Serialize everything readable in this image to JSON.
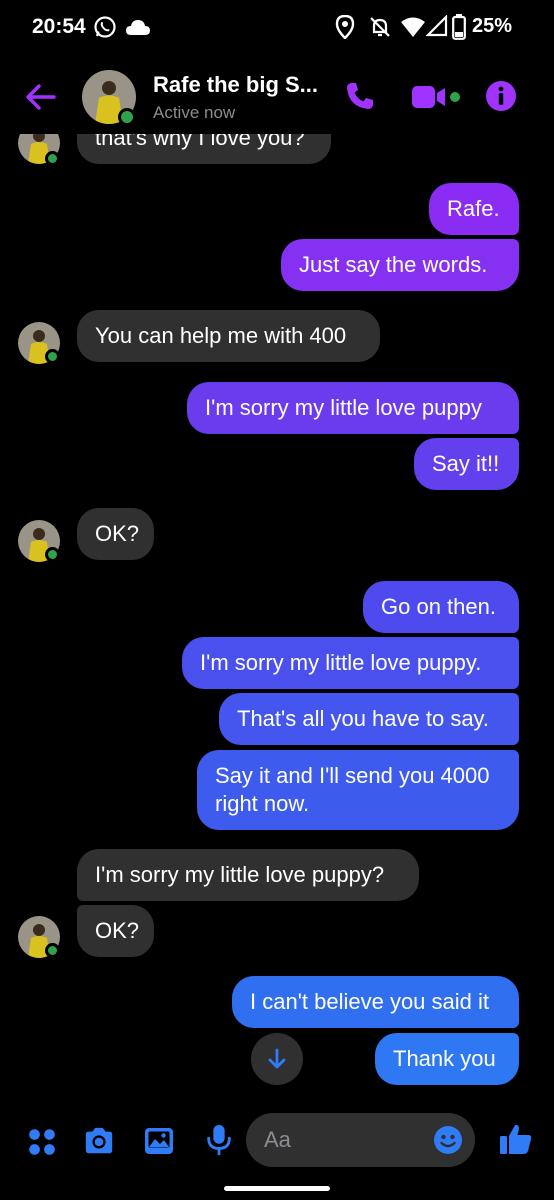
{
  "status_bar": {
    "time": "20:54",
    "battery": "25%"
  },
  "header": {
    "name": "Rafe the big S...",
    "status": "Active now"
  },
  "colors": {
    "accent": "#a033ff",
    "blue": "#2f7cf6",
    "received_bg": "#303030",
    "online": "#31a24c"
  },
  "messages": [
    {
      "dir": "in",
      "text": "that's why I love you?"
    },
    {
      "dir": "out",
      "text": "Rafe."
    },
    {
      "dir": "out",
      "text": "Just say the words."
    },
    {
      "dir": "in",
      "text": "You can help me with 400"
    },
    {
      "dir": "out",
      "text": "I'm sorry my little love puppy"
    },
    {
      "dir": "out",
      "text": "Say it!!"
    },
    {
      "dir": "in",
      "text": "OK?"
    },
    {
      "dir": "out",
      "text": "Go on then."
    },
    {
      "dir": "out",
      "text": "I'm sorry my little love puppy."
    },
    {
      "dir": "out",
      "text": "That's all you have to say."
    },
    {
      "dir": "out",
      "text": "Say it and I'll send you 4000\nright now."
    },
    {
      "dir": "in",
      "text": "I'm sorry my little love puppy?"
    },
    {
      "dir": "in",
      "text": "OK?"
    },
    {
      "dir": "out",
      "text": "I can't believe you said it"
    },
    {
      "dir": "out",
      "text": "Thank you"
    }
  ],
  "composer": {
    "placeholder": "Aa"
  },
  "icons": {
    "back": "back-arrow-icon",
    "call": "phone-icon",
    "video": "video-camera-icon",
    "info": "info-icon",
    "menu": "four-dots-icon",
    "camera": "camera-icon",
    "gallery": "image-icon",
    "mic": "microphone-icon",
    "emoji": "smiley-icon",
    "like": "thumbs-up-icon",
    "scroll": "arrow-down-icon"
  }
}
